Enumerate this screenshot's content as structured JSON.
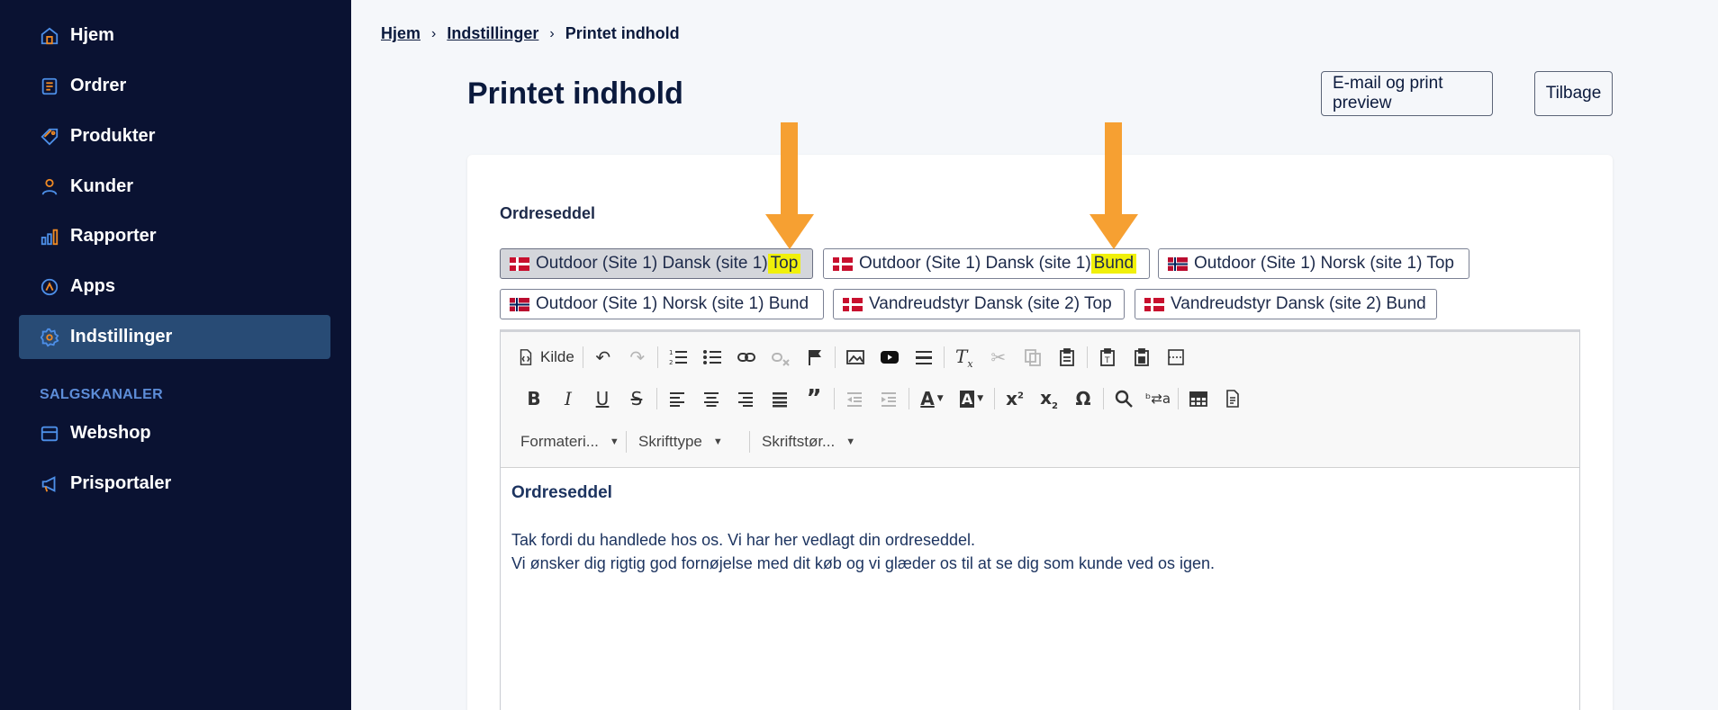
{
  "sidebar": {
    "items": [
      {
        "label": "Hjem",
        "icon": "home-icon"
      },
      {
        "label": "Ordrer",
        "icon": "orders-icon"
      },
      {
        "label": "Produkter",
        "icon": "tag-icon"
      },
      {
        "label": "Kunder",
        "icon": "user-icon"
      },
      {
        "label": "Rapporter",
        "icon": "bar-chart-icon"
      },
      {
        "label": "Apps",
        "icon": "apps-icon"
      },
      {
        "label": "Indstillinger",
        "icon": "gear-icon",
        "active": true
      }
    ],
    "section_label": "SALGSKANALER",
    "channels": [
      {
        "label": "Webshop",
        "icon": "store-icon"
      },
      {
        "label": "Prisportaler",
        "icon": "megaphone-icon"
      }
    ]
  },
  "breadcrumb": {
    "items": [
      "Hjem",
      "Indstillinger"
    ],
    "current": "Printet indhold"
  },
  "page": {
    "title": "Printet indhold",
    "preview_button": "E-mail og print preview",
    "back_button": "Tilbage"
  },
  "card": {
    "label": "Ordreseddel",
    "tabs": [
      {
        "text": "Outdoor (Site 1) Dansk (site 1) ",
        "highlight": "Top",
        "flag": "dk",
        "active": true
      },
      {
        "text": "Outdoor (Site 1) Dansk (site 1) ",
        "highlight": "Bund",
        "flag": "dk"
      },
      {
        "text": "Outdoor (Site 1) Norsk (site 1) Top",
        "highlight": "",
        "flag": "no"
      },
      {
        "text": "Outdoor (Site 1) Norsk (site 1) Bund",
        "highlight": "",
        "flag": "no"
      },
      {
        "text": "Vandreudstyr Dansk (site 2) Top",
        "highlight": "",
        "flag": "dk"
      },
      {
        "text": "Vandreudstyr Dansk (site 2) Bund",
        "highlight": "",
        "flag": "dk"
      }
    ]
  },
  "editor": {
    "source_label": "Kilde",
    "format_combo": "Formateri...",
    "font_combo": "Skrifttype",
    "size_combo": "Skriftstør...",
    "content": {
      "heading": "Ordreseddel",
      "line1": "Tak fordi du handlede hos os. Vi har her vedlagt din ordreseddel.",
      "line2": "Vi ønsker dig rigtig god fornøjelse med dit køb og vi glæder os til at se dig som kunde ved os igen."
    }
  },
  "colors": {
    "sidebar_bg": "#0a1232",
    "sidebar_active": "#284b75",
    "icon_orange": "#f08a24",
    "icon_blue": "#4d8fe8",
    "annotation_arrow": "#f6a032",
    "highlight": "#f0f00a"
  }
}
